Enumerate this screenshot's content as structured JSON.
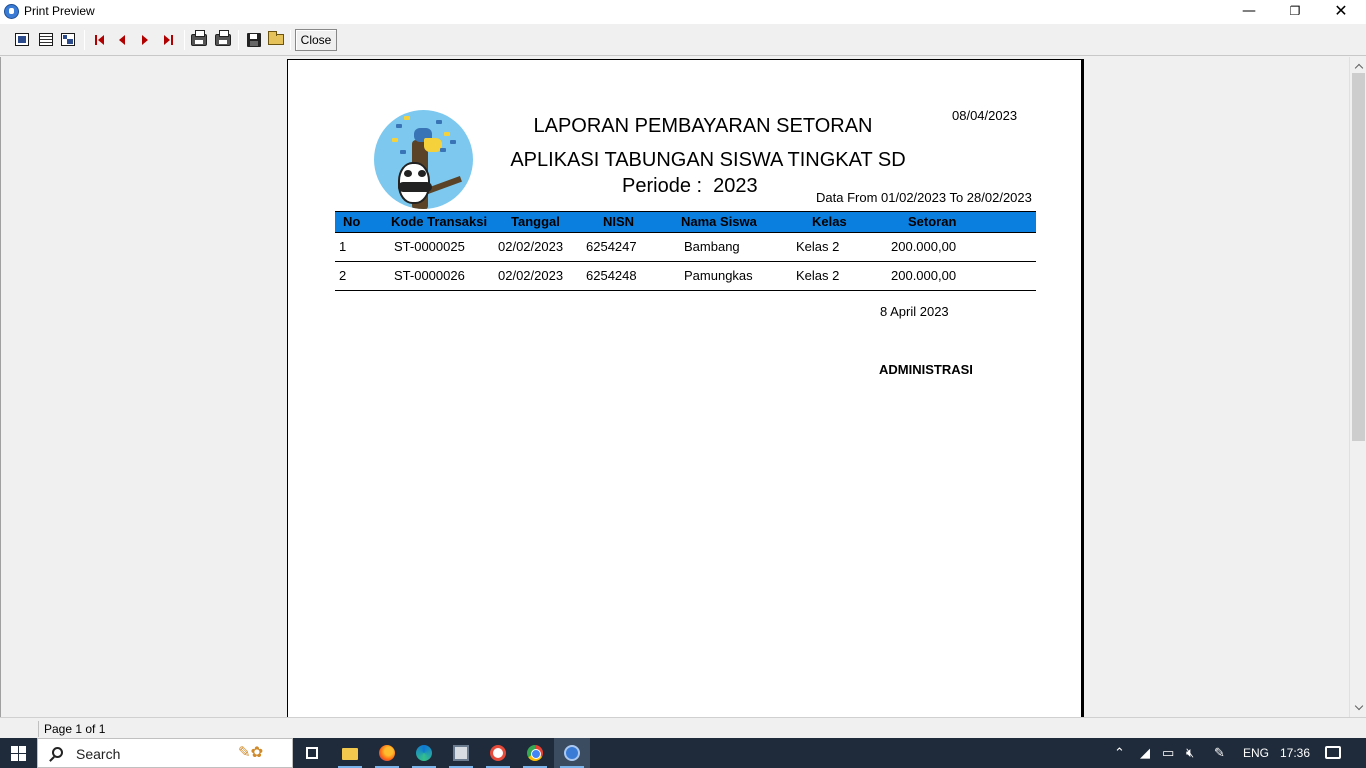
{
  "window": {
    "title": "Print Preview",
    "minimize_glyph": "—",
    "maximize_glyph": "❐",
    "close_glyph": "✕"
  },
  "toolbar": {
    "buttons": [
      {
        "name": "one-page-view-button",
        "icon": "page-icon"
      },
      {
        "name": "page-width-view-button",
        "icon": "lines-icon"
      },
      {
        "name": "multi-page-view-button",
        "icon": "multi-page-icon"
      },
      {
        "name": "first-page-button",
        "icon": "first-page-icon"
      },
      {
        "name": "previous-page-button",
        "icon": "previous-icon"
      },
      {
        "name": "next-page-button",
        "icon": "next-icon"
      },
      {
        "name": "last-page-button",
        "icon": "last-page-icon"
      },
      {
        "name": "print-setup-button",
        "icon": "printer-setup-icon"
      },
      {
        "name": "print-button",
        "icon": "printer-icon"
      },
      {
        "name": "save-button",
        "icon": "save-icon"
      },
      {
        "name": "open-button",
        "icon": "open-folder-icon"
      }
    ],
    "close_label": "Close"
  },
  "report": {
    "title1": "LAPORAN PEMBAYARAN SETORAN",
    "title2": "APLIKASI TABUNGAN SISWA TINGKAT SD",
    "period": "Periode :  2023",
    "print_date": "08/04/2023",
    "date_range": "Data From 01/02/2023 To 28/02/2023",
    "columns": [
      "No",
      "Kode Transaksi",
      "Tanggal",
      "NISN",
      "Nama Siswa",
      "Kelas",
      "Setoran"
    ],
    "rows": [
      [
        "1",
        "ST-0000025",
        "02/02/2023",
        "6254247",
        "Bambang",
        "Kelas 2",
        "200.000,00"
      ],
      [
        "2",
        "ST-0000026",
        "02/02/2023",
        "6254248",
        "Pamungkas",
        "Kelas 2",
        "200.000,00"
      ]
    ],
    "sign_date": "8 April 2023",
    "sign_name": "ADMINISTRASI",
    "header_color": "#0b7fe0"
  },
  "statusbar": {
    "page_text": "Page 1 of 1"
  },
  "taskbar": {
    "search_label": "Search",
    "lang": "ENG",
    "time": "17:36",
    "apps": [
      "task-view",
      "file-explorer",
      "firefox",
      "edge",
      "generic-app",
      "red-app",
      "chrome",
      "print-preview-app"
    ]
  }
}
